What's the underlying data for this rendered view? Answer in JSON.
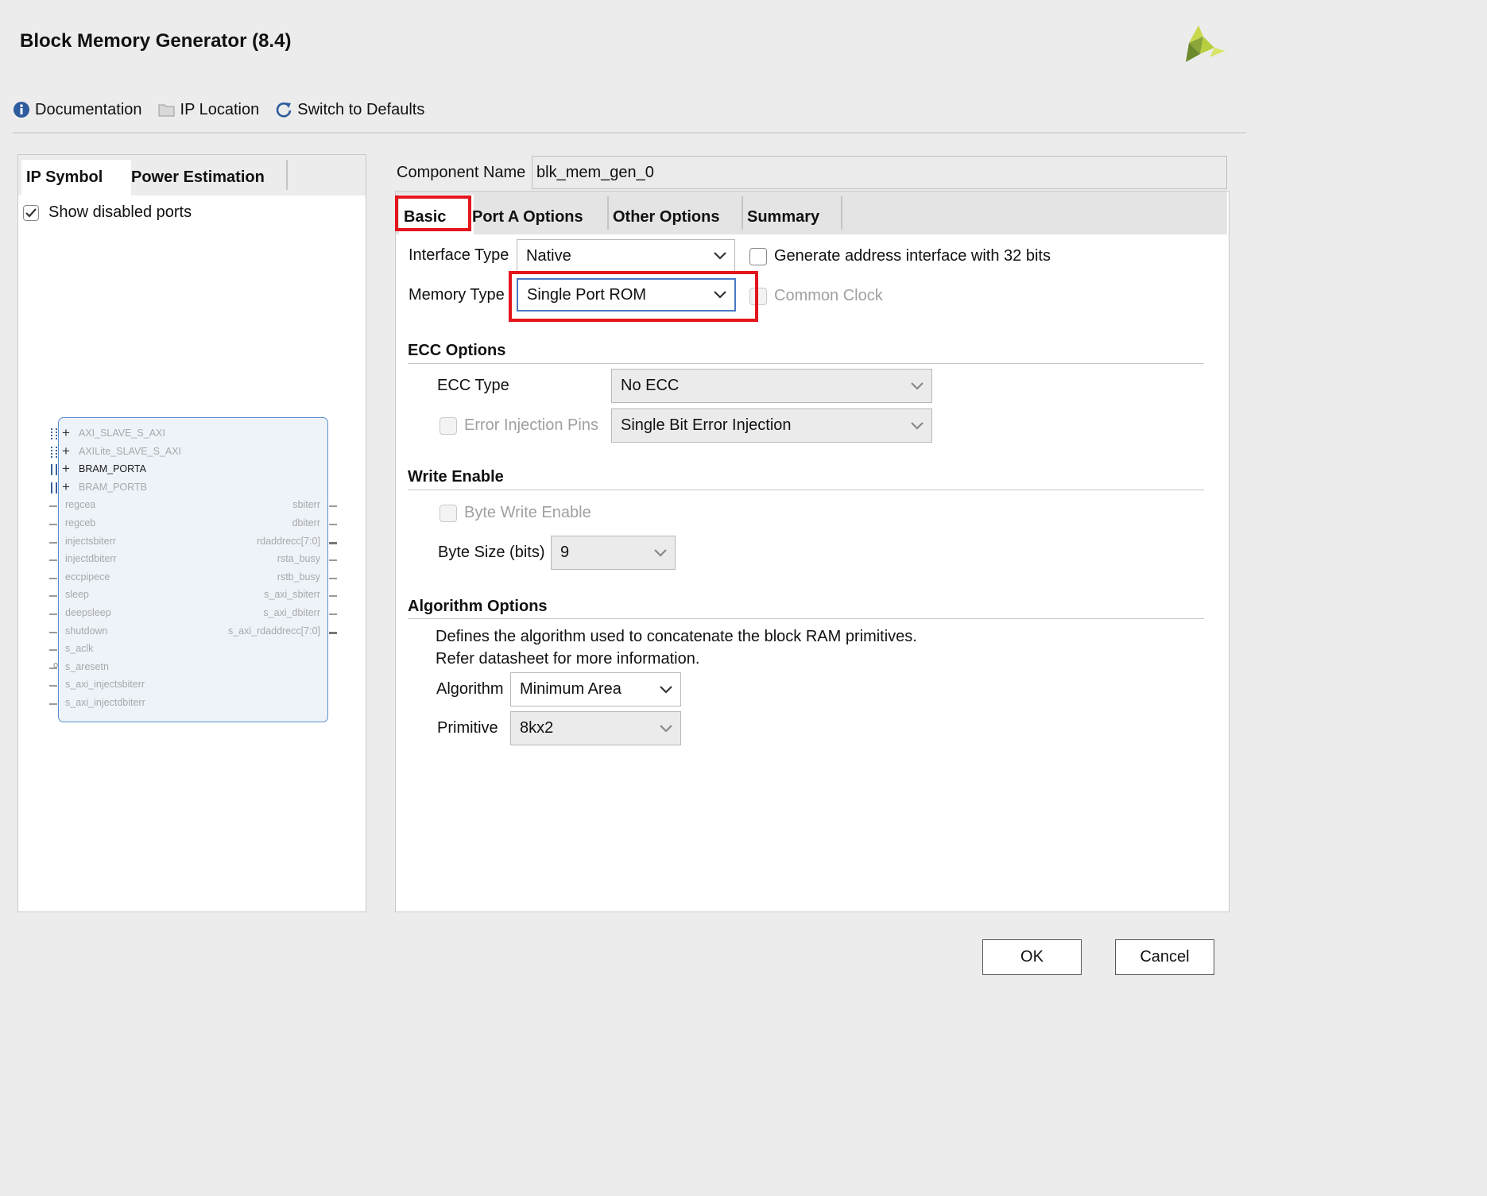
{
  "window": {
    "title": "Block Memory Generator (8.4)"
  },
  "toolbar": {
    "documentation": "Documentation",
    "ip_location": "IP Location",
    "switch_defaults": "Switch to Defaults"
  },
  "left": {
    "tabs": [
      "IP Symbol",
      "Power Estimation"
    ],
    "show_disabled_ports": "Show disabled ports",
    "buses": [
      "AXI_SLAVE_S_AXI",
      "AXILite_SLAVE_S_AXI",
      "BRAM_PORTA",
      "BRAM_PORTB"
    ],
    "left_ports": [
      "regcea",
      "regceb",
      "injectsbiterr",
      "injectdbiterr",
      "eccpipece",
      "sleep",
      "deepsleep",
      "shutdown",
      "s_aclk",
      "s_aresetn",
      "s_axi_injectsbiterr",
      "s_axi_injectdbiterr"
    ],
    "right_ports": [
      "sbiterr",
      "dbiterr",
      "rdaddrecc[7:0]",
      "rsta_busy",
      "rstb_busy",
      "s_axi_sbiterr",
      "s_axi_dbiterr",
      "s_axi_rdaddrecc[7:0]"
    ]
  },
  "component": {
    "label": "Component Name",
    "value": "blk_mem_gen_0"
  },
  "tabs": [
    "Basic",
    "Port A Options",
    "Other Options",
    "Summary"
  ],
  "basic": {
    "interface_type_label": "Interface Type",
    "interface_type": "Native",
    "gen_addr_32": "Generate address interface with 32 bits",
    "memory_type_label": "Memory Type",
    "memory_type": "Single Port ROM",
    "common_clock": "Common Clock",
    "ecc": {
      "title": "ECC Options",
      "type_label": "ECC Type",
      "type": "No ECC",
      "error_pins": "Error Injection Pins",
      "error_type": "Single Bit Error Injection"
    },
    "write_enable": {
      "title": "Write Enable",
      "byte_write": "Byte Write Enable",
      "byte_size_label": "Byte Size (bits)",
      "byte_size": "9"
    },
    "algorithm": {
      "title": "Algorithm Options",
      "desc1": "Defines the algorithm used to concatenate the block RAM primitives.",
      "desc2": "Refer datasheet for more information.",
      "algo_label": "Algorithm",
      "algo": "Minimum Area",
      "prim_label": "Primitive",
      "prim": "8kx2"
    }
  },
  "buttons": {
    "ok": "OK",
    "cancel": "Cancel"
  },
  "colors": {
    "highlight": "#e3141c",
    "focus": "#4a79c4",
    "symbol_border": "#5b8fce",
    "info_icon": "#2f5c9e"
  }
}
